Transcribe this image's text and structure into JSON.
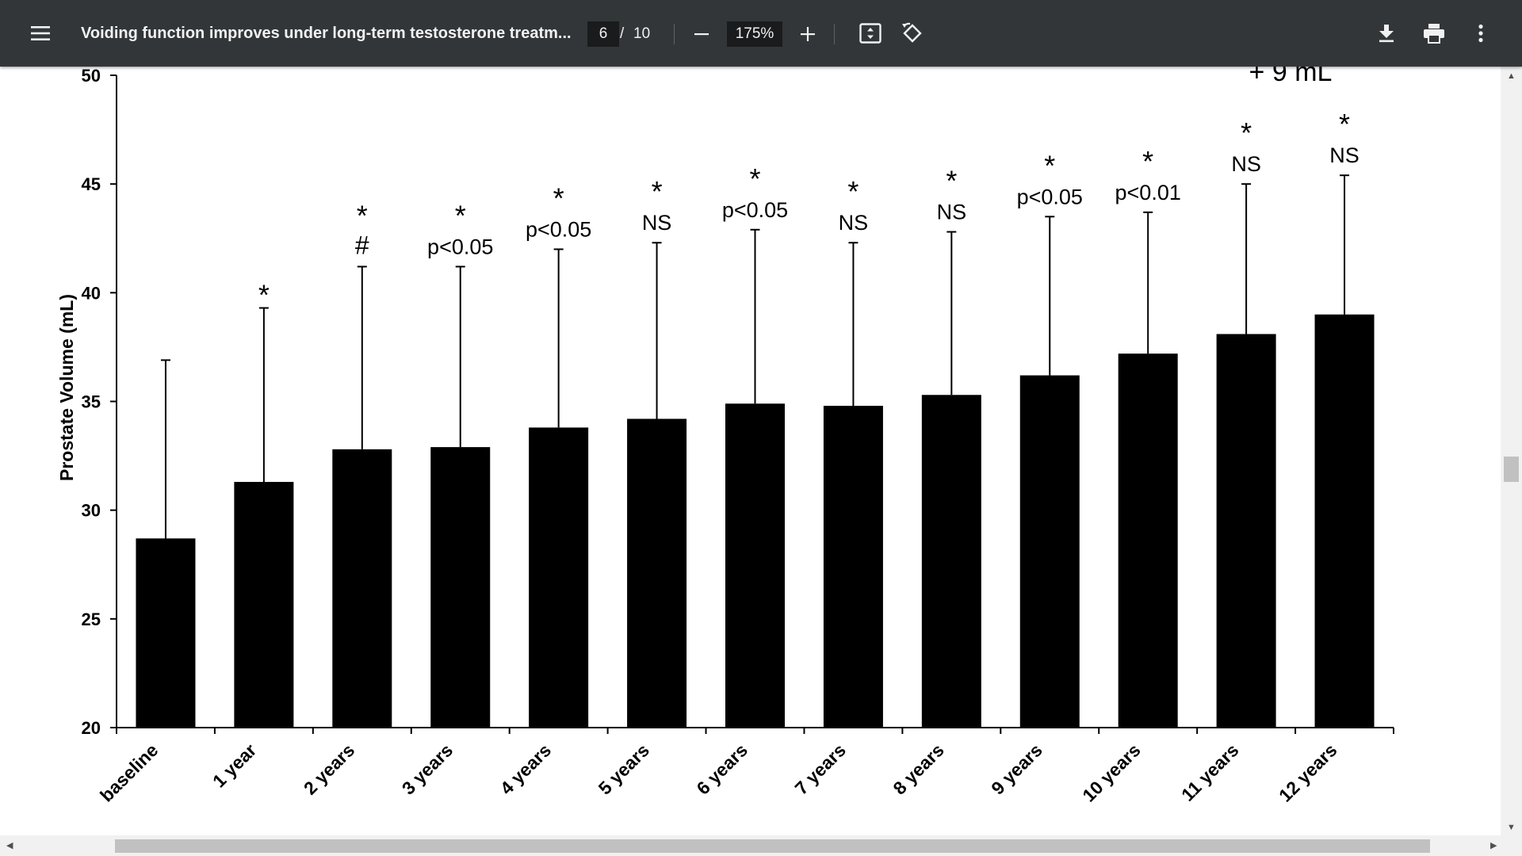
{
  "toolbar": {
    "menu_icon": "hamburger-menu-icon",
    "title": "Voiding function improves under long-term testosterone treatm...",
    "current_page": "6",
    "page_separator": "/",
    "total_pages": "10",
    "zoom_out_icon": "minus-icon",
    "zoom": "175%",
    "zoom_in_icon": "plus-icon",
    "fit_icon": "fit-to-page-icon",
    "rotate_icon": "rotate-icon",
    "download_icon": "download-icon",
    "print_icon": "print-icon",
    "more_icon": "more-vert-icon"
  },
  "chart_data": {
    "type": "bar",
    "title": "",
    "top_annotation": "+ 9 mL",
    "xlabel": "",
    "ylabel": "Prostate Volume  (mL)",
    "ylim": [
      20,
      50
    ],
    "yticks": [
      "20",
      "25",
      "30",
      "35",
      "40",
      "45",
      "50"
    ],
    "ytick_values": [
      20,
      25,
      30,
      35,
      40,
      45,
      50
    ],
    "grid": false,
    "bar_color": "#000000",
    "categories": [
      "baseline",
      "1 year",
      "2 years",
      "3 years",
      "4 years",
      "5 years",
      "6 years",
      "7 years",
      "8 years",
      "9 years",
      "10 years",
      "11 years",
      "12 years"
    ],
    "values": [
      28.7,
      31.3,
      32.8,
      32.9,
      33.8,
      34.2,
      34.9,
      34.8,
      35.3,
      36.2,
      37.2,
      38.1,
      39.0
    ],
    "error_upper": [
      36.9,
      39.3,
      41.2,
      41.2,
      42.0,
      42.3,
      42.9,
      42.3,
      42.8,
      43.5,
      43.7,
      45.0,
      45.4
    ],
    "significance": [
      "",
      "*",
      "*",
      "*",
      "*",
      "*",
      "*",
      "*",
      "*",
      "*",
      "*",
      "*",
      "*"
    ],
    "annotations": [
      "",
      "",
      "#",
      "p<0.05",
      "p<0.05",
      "NS",
      "p<0.05",
      "NS",
      "NS",
      "p<0.05",
      "p<0.01",
      "NS",
      "NS"
    ]
  }
}
